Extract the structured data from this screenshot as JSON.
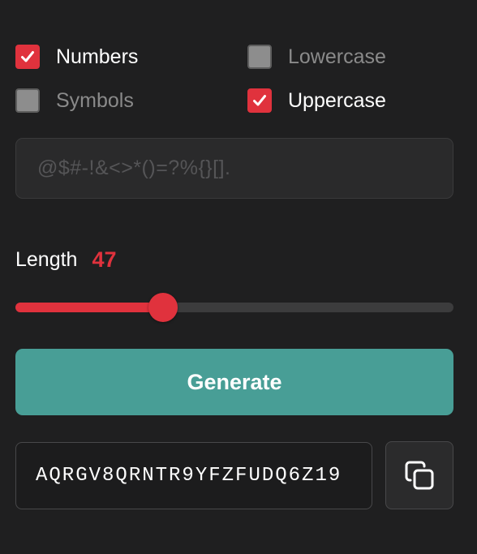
{
  "options": [
    {
      "name": "numbers",
      "label": "Numbers",
      "checked": true
    },
    {
      "name": "lowercase",
      "label": "Lowercase",
      "checked": false
    },
    {
      "name": "symbols",
      "label": "Symbols",
      "checked": false
    },
    {
      "name": "uppercase",
      "label": "Uppercase",
      "checked": true
    }
  ],
  "symbols_field": {
    "placeholder": "@$#-!&<>*()=?%{}[]."
  },
  "length": {
    "label": "Length",
    "value": "47",
    "slider_fraction": 0.337
  },
  "generate_button": {
    "label": "Generate"
  },
  "output": {
    "password": "AQRGV8QRNTR9YFZFUDQ6Z19"
  },
  "copy_button": {
    "icon": "copy-icon"
  },
  "colors": {
    "background": "#1f1f20",
    "accent_red": "#e0323d",
    "generate_teal": "#489e96",
    "unchecked_gray": "#8d8d8d"
  }
}
